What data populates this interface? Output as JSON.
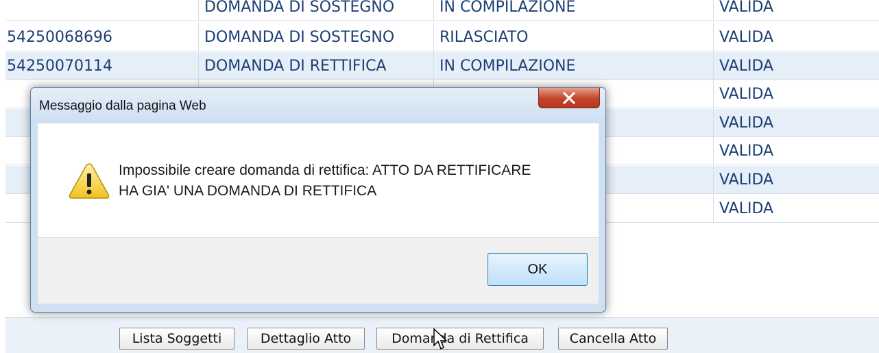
{
  "table": {
    "rows": [
      {
        "id": "",
        "tipo": "DOMANDA DI SOSTEGNO",
        "stato": "IN COMPILAZIONE",
        "validita": "VALIDA"
      },
      {
        "id": "54250068696",
        "tipo": "DOMANDA DI SOSTEGNO",
        "stato": "RILASCIATO",
        "validita": "VALIDA"
      },
      {
        "id": "54250070114",
        "tipo": "DOMANDA DI RETTIFICA",
        "stato": "IN COMPILAZIONE",
        "validita": "VALIDA"
      },
      {
        "id": "",
        "tipo": "",
        "stato": "",
        "validita": "VALIDA"
      },
      {
        "id": "",
        "tipo": "",
        "stato": "",
        "validita": "VALIDA"
      },
      {
        "id": "",
        "tipo": "",
        "stato": "",
        "validita": "VALIDA"
      },
      {
        "id": "",
        "tipo": "",
        "stato": "",
        "validita": "VALIDA"
      },
      {
        "id": "",
        "tipo": "",
        "stato": "",
        "validita": "VALIDA"
      }
    ]
  },
  "buttons": {
    "lista_soggetti": "Lista Soggetti",
    "dettaglio_atto": "Dettaglio Atto",
    "domanda_rettifica": "Domanda di Rettifica",
    "cancella_atto": "Cancella Atto"
  },
  "dialog": {
    "title": "Messaggio dalla pagina Web",
    "message_line1": "Impossibile creare domanda di rettifica: ATTO DA RETTIFICARE",
    "message_line2": "HA GIA' UNA DOMANDA DI RETTIFICA",
    "ok_label": "OK",
    "icon": "warning-icon",
    "close_icon": "close-icon"
  },
  "colors": {
    "table_text": "#1c3f73",
    "alt_row": "#e6eef8",
    "close_button": "#c2432b"
  }
}
